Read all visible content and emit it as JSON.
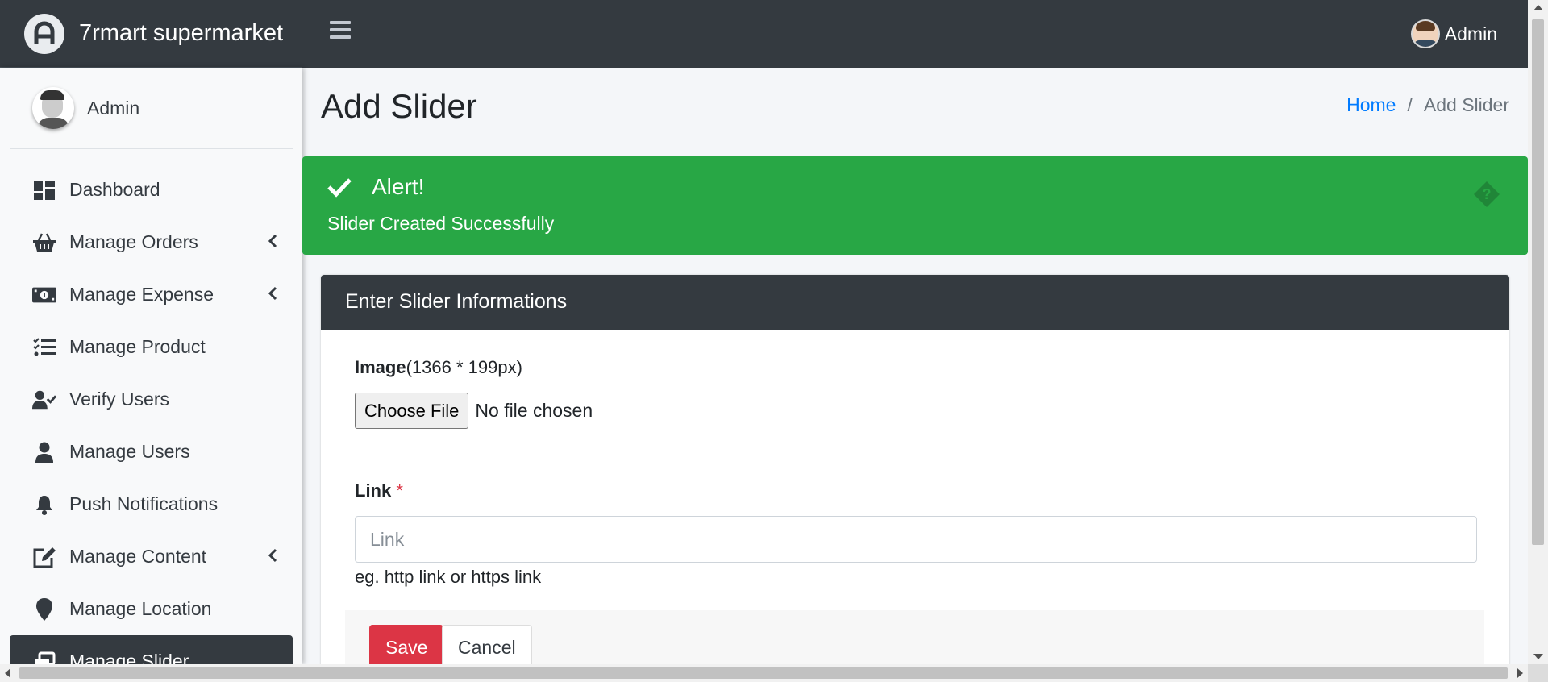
{
  "brand": {
    "name": "7rmart supermarket",
    "icon": "brand-logo-icon"
  },
  "topbar": {
    "menu_icon": "hamburger-icon",
    "user_name": "Admin"
  },
  "sidebar": {
    "user_name": "Admin",
    "items": [
      {
        "label": "Dashboard",
        "icon": "dashboard-icon",
        "has_children": false
      },
      {
        "label": "Manage Orders",
        "icon": "basket-icon",
        "has_children": true
      },
      {
        "label": "Manage Expense",
        "icon": "money-icon",
        "has_children": true
      },
      {
        "label": "Manage Product",
        "icon": "tasks-icon",
        "has_children": false
      },
      {
        "label": "Verify Users",
        "icon": "user-check-icon",
        "has_children": false
      },
      {
        "label": "Manage Users",
        "icon": "user-icon",
        "has_children": false
      },
      {
        "label": "Push Notifications",
        "icon": "bell-icon",
        "has_children": false
      },
      {
        "label": "Manage Content",
        "icon": "edit-icon",
        "has_children": true
      },
      {
        "label": "Manage Location",
        "icon": "map-marker-icon",
        "has_children": false
      },
      {
        "label": "Manage Slider",
        "icon": "slider-icon",
        "has_children": false,
        "active": true
      }
    ]
  },
  "page": {
    "title": "Add Slider",
    "breadcrumb": {
      "home": "Home",
      "separator": "/",
      "current": "Add Slider"
    }
  },
  "alert": {
    "title": "Alert!",
    "message": "Slider Created Successfully",
    "color": "#28a745"
  },
  "form": {
    "header": "Enter Slider Informations",
    "image_label": "Image",
    "image_hint": "(1366 * 199px)",
    "file_button": "Choose File",
    "file_status": "No file chosen",
    "link_label": "Link",
    "required_mark": "*",
    "link_placeholder": "Link",
    "link_value": "",
    "link_help": "eg. http link or https link",
    "save_label": "Save",
    "cancel_label": "Cancel"
  },
  "colors": {
    "dark": "#343a40",
    "danger": "#dc3545",
    "primary": "#007bff",
    "success": "#28a745"
  }
}
